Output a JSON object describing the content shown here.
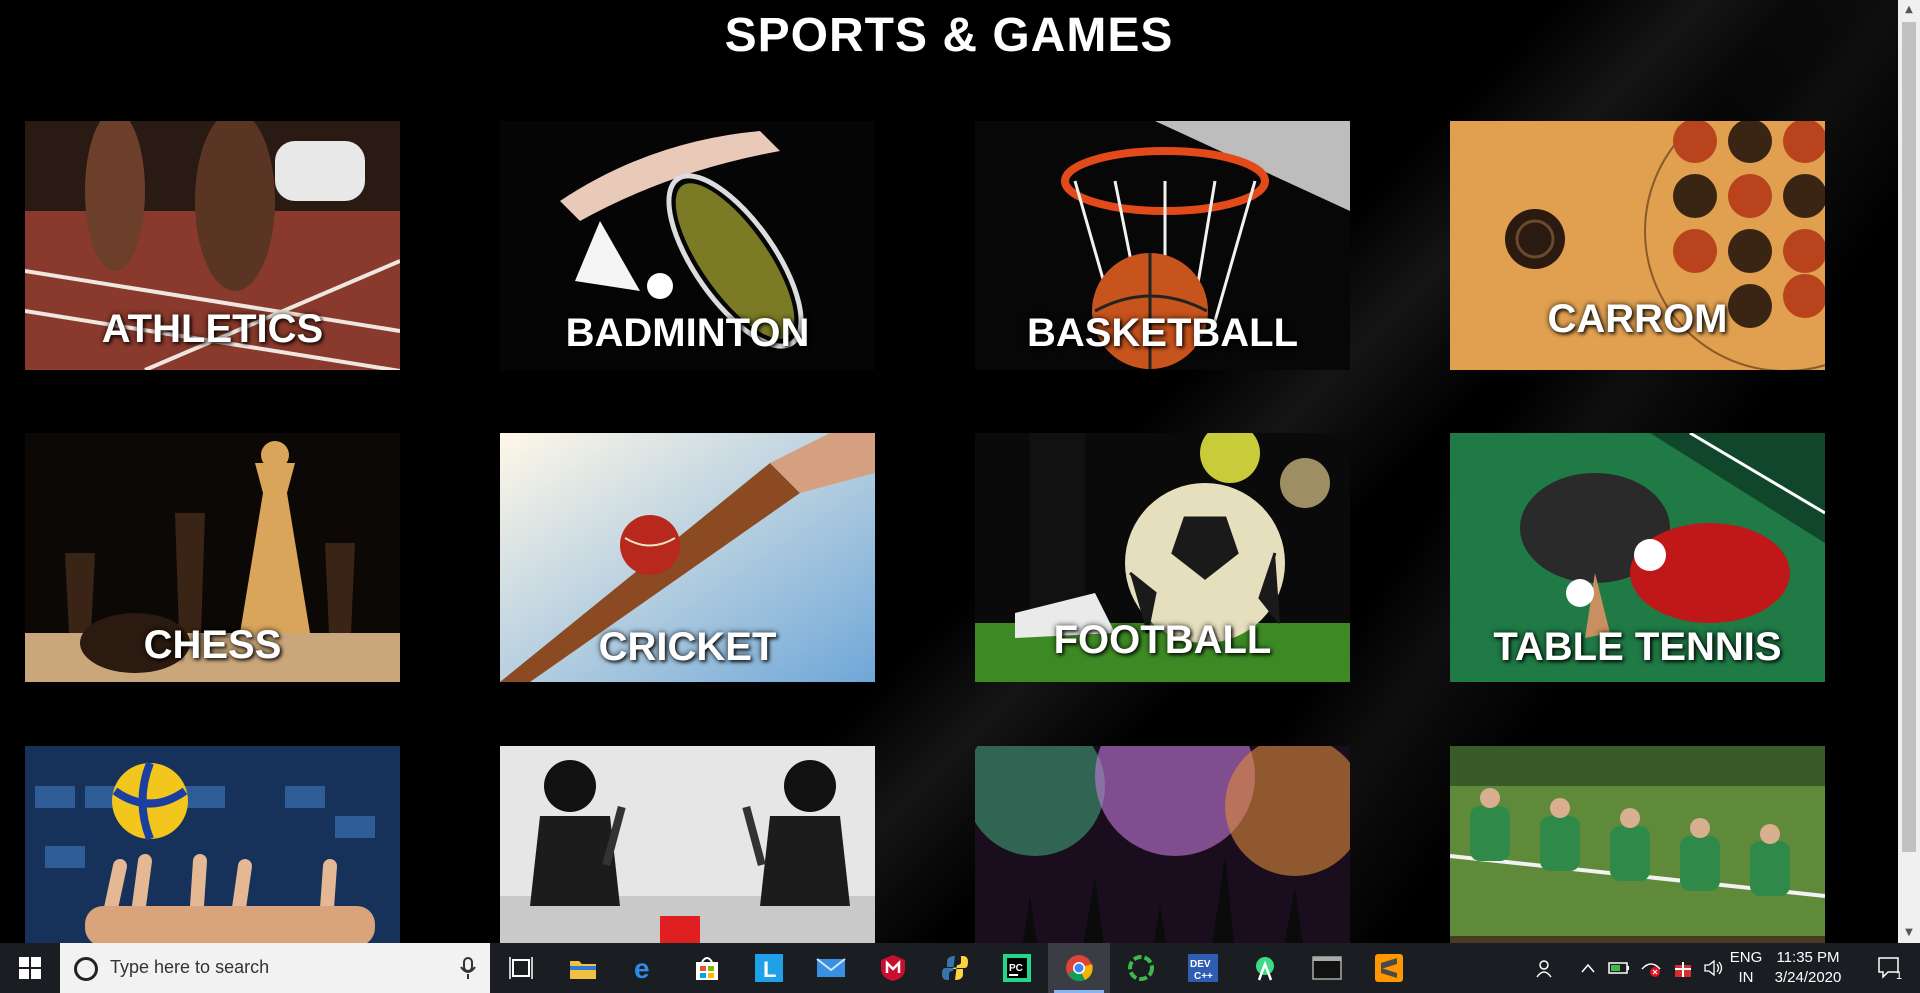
{
  "page": {
    "title": "SPORTS & GAMES"
  },
  "cards": [
    {
      "label": "ATHLETICS"
    },
    {
      "label": "BADMINTON"
    },
    {
      "label": "BASKETBALL"
    },
    {
      "label": "CARROM"
    },
    {
      "label": "CHESS"
    },
    {
      "label": "CRICKET"
    },
    {
      "label": "FOOTBALL"
    },
    {
      "label": "TABLE TENNIS"
    },
    {
      "label": ""
    },
    {
      "label": ""
    },
    {
      "label": ""
    },
    {
      "label": ""
    }
  ],
  "taskbar": {
    "search_placeholder": "Type here to search",
    "lang_line1": "ENG",
    "lang_line2": "IN",
    "time": "11:35 PM",
    "date": "3/24/2020",
    "notification_count": "1",
    "apps": [
      "task-view",
      "file-explorer",
      "edge",
      "store",
      "l-app",
      "mail",
      "mcafee",
      "python",
      "pycharm",
      "chrome",
      "spinner-app",
      "dev-cpp",
      "android-studio",
      "terminal",
      "sublime-text"
    ]
  },
  "colors": {
    "background": "#000000",
    "title": "#ffffff",
    "taskbar": "#1a1d22"
  }
}
